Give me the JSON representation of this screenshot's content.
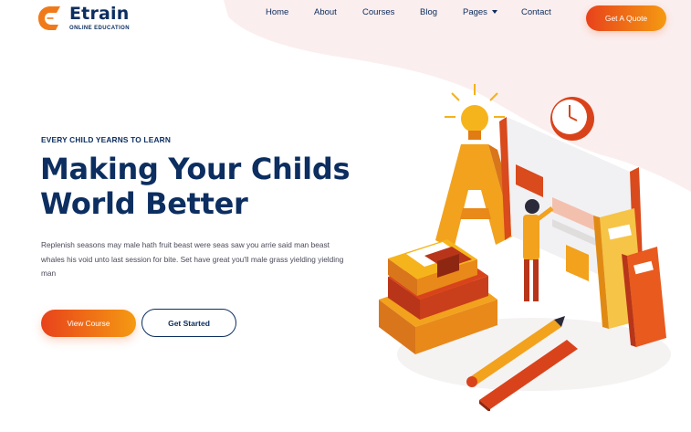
{
  "brand": {
    "name": "Etrain",
    "tagline": "ONLINE EDUCATION",
    "logo_icon": "e-letter-logo-icon"
  },
  "nav": {
    "items": [
      {
        "label": "Home"
      },
      {
        "label": "About"
      },
      {
        "label": "Courses"
      },
      {
        "label": "Blog"
      },
      {
        "label": "Pages",
        "has_dropdown": true
      },
      {
        "label": "Contact"
      }
    ],
    "cta_label": "Get A Quote"
  },
  "hero": {
    "eyebrow": "EVERY CHILD YEARNS TO LEARN",
    "headline_line1": "Making Your Childs",
    "headline_line2": "World Better",
    "description": "Replenish seasons may male hath fruit beast were seas saw you arrie said man beast whales his void unto last session for bite. Set have great you'll male grass yielding yielding man",
    "primary_button": "View Course",
    "secondary_button": "Get Started"
  },
  "colors": {
    "navy": "#0c2e60",
    "accent_start": "#e8421b",
    "accent_end": "#f59a12",
    "blob": "#fbeeee"
  }
}
